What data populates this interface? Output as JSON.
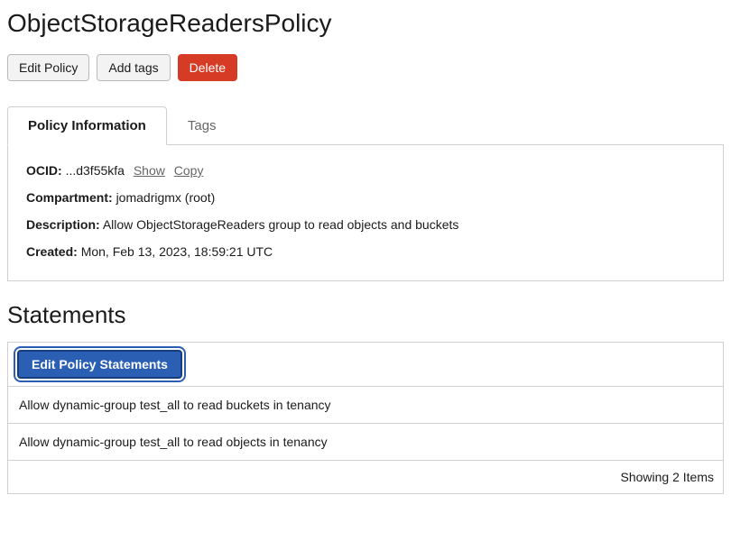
{
  "title": "ObjectStorageReadersPolicy",
  "actions": {
    "edit": "Edit Policy",
    "addTags": "Add tags",
    "delete": "Delete"
  },
  "tabs": {
    "info": "Policy Information",
    "tags": "Tags"
  },
  "info": {
    "ocidLabel": "OCID:",
    "ocidValue": "...d3f55kfa",
    "showLink": "Show",
    "copyLink": "Copy",
    "compartmentLabel": "Compartment:",
    "compartmentValue": "jomadrigmx (root)",
    "descriptionLabel": "Description:",
    "descriptionValue": " Allow ObjectStorageReaders group to read objects and buckets",
    "createdLabel": "Created:",
    "createdValue": "Mon, Feb 13, 2023, 18:59:21 UTC"
  },
  "statements": {
    "header": "Statements",
    "editBtn": "Edit Policy Statements",
    "rows": [
      "Allow dynamic-group test_all to read buckets in tenancy",
      "Allow dynamic-group test_all to read objects in tenancy"
    ],
    "footer": "Showing 2 Items"
  }
}
